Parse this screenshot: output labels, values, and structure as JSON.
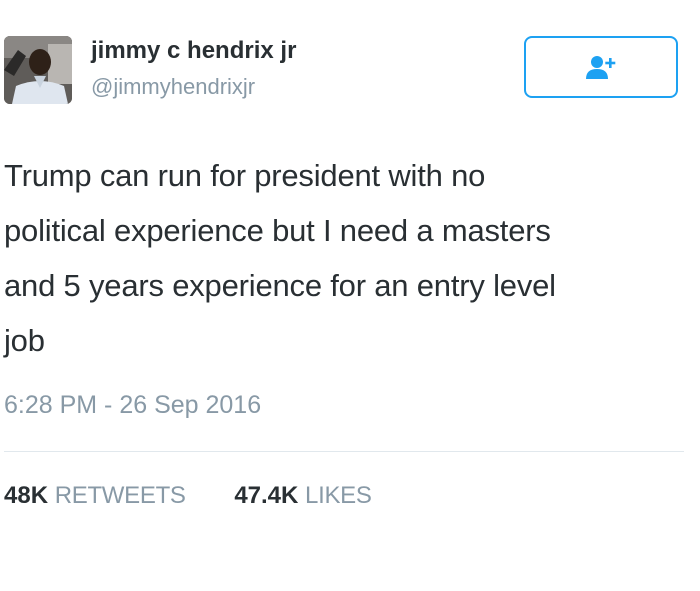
{
  "user": {
    "name": "jimmy c hendrix jr",
    "handle": "@jimmyhendrixjr"
  },
  "follow_button": {
    "icon": "add-user-icon",
    "color": "#1da1f2"
  },
  "tweet": {
    "text_lines": [
      "Trump can run for president with no",
      "political experience but I need a masters",
      "and 5 years experience for an entry level",
      "job"
    ],
    "timestamp": "6:28 PM - 26 Sep 2016"
  },
  "stats": {
    "retweets_count": "48K",
    "retweets_label": "RETWEETS",
    "likes_count": "47.4K",
    "likes_label": "LIKES"
  },
  "colors": {
    "text": "#292f33",
    "secondary": "#8899a6",
    "accent": "#1da1f2",
    "divider": "#e1e8ed"
  }
}
